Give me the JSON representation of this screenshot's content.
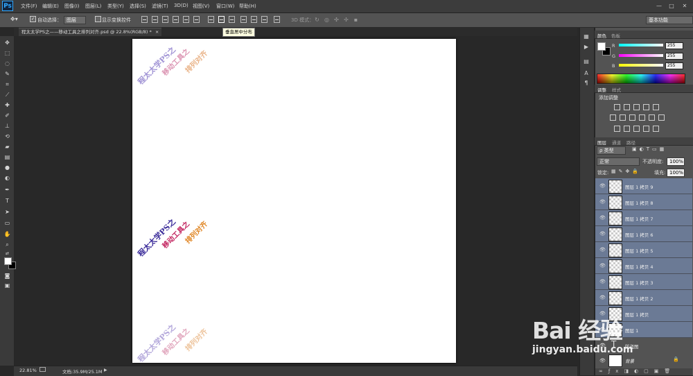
{
  "app": {
    "logo": "Ps"
  },
  "menu": [
    "文件(F)",
    "编辑(E)",
    "图像(I)",
    "图层(L)",
    "类型(Y)",
    "选择(S)",
    "滤镜(T)",
    "3D(D)",
    "视图(V)",
    "窗口(W)",
    "帮助(H)"
  ],
  "window_controls": [
    "—",
    "□",
    "✕"
  ],
  "options": {
    "auto_select_label": "自动选择：",
    "auto_select_value": "图层",
    "show_transform_label": "显示变换控件",
    "mode_3d_label": "3D 模式：",
    "workspace": "基本功能"
  },
  "document": {
    "tab_title": "程太太学PS之——移动工具之排列对齐.psd @ 22.8%(RGB/8) *",
    "tab_close": "×"
  },
  "tooltip": "垂直居中分布",
  "canvas_text": {
    "line1": "程太太学PS之",
    "line2": "移动工具之",
    "line3": "排列对齐"
  },
  "status": {
    "zoom": "22.81%",
    "doc_info": "文档:35.9M/25.1M",
    "arrow": "▶"
  },
  "color_panel": {
    "tabs": [
      "颜色",
      "色板"
    ],
    "r_label": "R",
    "r_value": "255",
    "g_label": "G",
    "g_value": "255",
    "b_label": "B",
    "b_value": "255"
  },
  "adjust_panel": {
    "tabs": [
      "调整",
      "样式"
    ],
    "title": "添加调整"
  },
  "layers_panel": {
    "tabs": [
      "图层",
      "通道",
      "路径"
    ],
    "kind": "ρ 类型",
    "blend_mode": "正常",
    "opacity_label": "不透明度:",
    "opacity_value": "100%",
    "lock_label": "锁定:",
    "fill_label": "填充:",
    "fill_value": "100%",
    "layers": [
      "图层 1 拷贝 9",
      "图层 1 拷贝 8",
      "图层 1 拷贝 7",
      "图层 1 拷贝 6",
      "图层 1 拷贝 5",
      "图层 1 拷贝 4",
      "图层 1 拷贝 3",
      "图层 1 拷贝 2",
      "图层 1 拷贝",
      "图层 1"
    ],
    "text_layer": "防盗图",
    "background_layer": "背景"
  },
  "watermark": {
    "logo": "Bai 经验",
    "url": "jingyan.baidu.com"
  }
}
